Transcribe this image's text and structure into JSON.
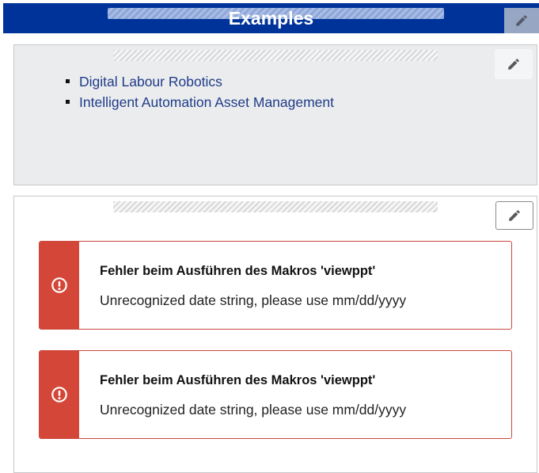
{
  "header": {
    "title": "Examples"
  },
  "links_section": {
    "links": [
      {
        "label": "Digital Labour Robotics"
      },
      {
        "label": "Intelligent Automation Asset Management"
      }
    ]
  },
  "errors": [
    {
      "title": "Fehler beim Ausführen des Makros 'viewppt'",
      "message": "Unrecognized date string, please use mm/dd/yyyy"
    },
    {
      "title": "Fehler beim Ausführen des Makros 'viewppt'",
      "message": "Unrecognized date string, please use mm/dd/yyyy"
    }
  ],
  "icons": {
    "edit": "pencil-icon",
    "error": "exclamation-circle-icon"
  },
  "colors": {
    "header_bg": "#003399",
    "link": "#1f3c88",
    "error_red": "#d44637",
    "section_gray": "#ebecee"
  }
}
